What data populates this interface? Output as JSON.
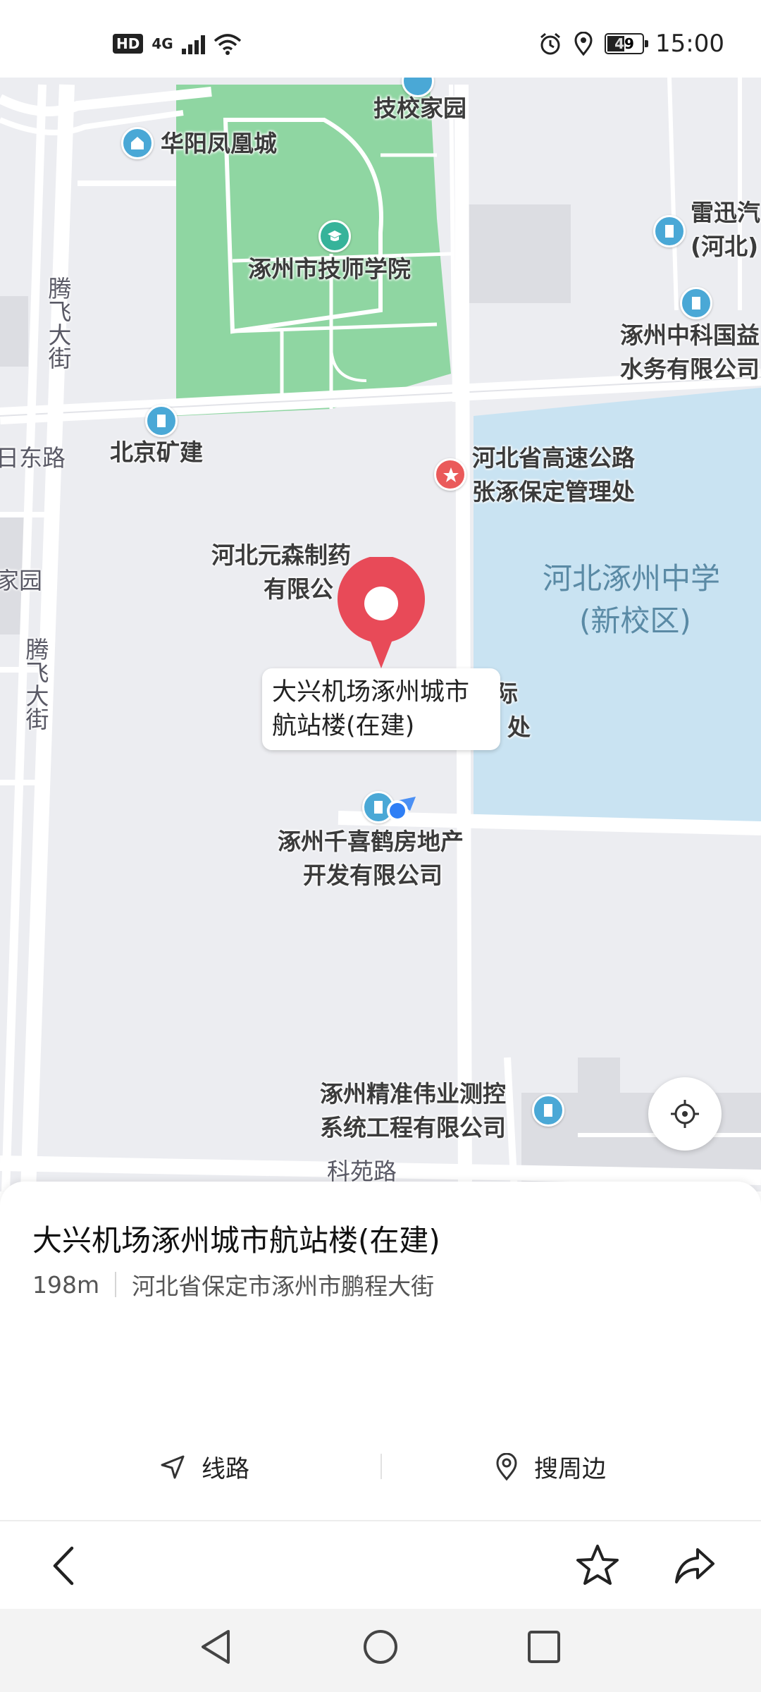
{
  "status_bar": {
    "hd_label": "HD",
    "network_label": "4G",
    "battery_level": "49",
    "time": "15:00"
  },
  "map": {
    "labels": {
      "jixiao_jiayuan": "技校家园",
      "huayang_fenghuangcheng": "华阳凤凰城",
      "zhuozhou_jishi_xueyuan": "涿州市技师学院",
      "leixun_line1": "雷迅汽",
      "leixun_line2": "(河北)",
      "zhongke_line1": "涿州中科国益",
      "zhongke_line2": "水务有限公司",
      "beijing_kuangjian": "北京矿建",
      "gaosu_line1": "河北省高速公路",
      "gaosu_line2": "张涿保定管理处",
      "yuansen_line1": "河北元森制药",
      "yuansen_line2": "有限公",
      "zhongxue_line1": "河北涿州中学",
      "zhongxue_line2": "(新校区)",
      "guoji_partial1": "际",
      "guoji_partial2": "处",
      "qianxihe_line1": "涿州千喜鹤房地产",
      "qianxihe_line2": "开发有限公司",
      "jingzhun_line1": "涿州精准伟业测控",
      "jingzhun_line2": "系统工程有限公司",
      "road_dong": "日东路",
      "road_jiayuan": "家园",
      "road_tengfei_1": "腾飞大街",
      "road_tengfei_2": "腾飞大街",
      "road_keyuan": "科苑路"
    },
    "callout": "大兴机场涿州城市航站楼(在建)",
    "pin_color": "#e84a58",
    "water_color": "#c9e3f2",
    "park_color": "#8fd6a2",
    "poi_color": "#4aa8d6",
    "my_location_color": "#2f7ff5"
  },
  "place": {
    "title": "大兴机场涿州城市航站楼(在建)",
    "distance": "198m",
    "address": "河北省保定市涿州市鹏程大街"
  },
  "actions": {
    "route_label": "线路",
    "nearby_label": "搜周边"
  },
  "icons": {
    "back": "chevron-left-icon",
    "favorite": "star-icon",
    "share": "share-icon",
    "locate": "crosshair-icon",
    "route": "navigation-arrow-icon",
    "nearby": "location-pin-icon"
  }
}
